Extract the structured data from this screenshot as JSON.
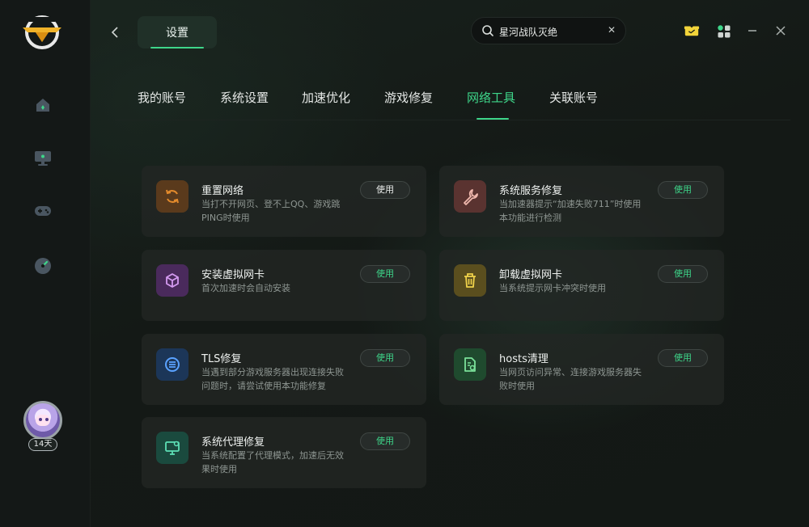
{
  "header": {
    "title": "设置",
    "search": {
      "value": "星河战队灭绝"
    }
  },
  "sidebar": {
    "days_badge": "14天",
    "items": [
      {
        "icon": "home-icon"
      },
      {
        "icon": "monitor-icon"
      },
      {
        "icon": "gamepad-icon"
      },
      {
        "icon": "speedometer-icon"
      }
    ]
  },
  "tabs": [
    "我的账号",
    "系统设置",
    "加速优化",
    "游戏修复",
    "网络工具",
    "关联账号"
  ],
  "active_tab": "网络工具",
  "tools": [
    {
      "title": "重置网络",
      "desc": "当打不开网页、登不上QQ、游戏跳PING时使用",
      "button": "使用",
      "icon": "refresh-icon",
      "color": "#c07a2c",
      "bg": "#5a3a1c"
    },
    {
      "title": "系统服务修复",
      "desc": "当加速器提示“加速失败711”时使用本功能进行检测",
      "button": "使用",
      "icon": "wrench-icon",
      "color": "#e7a59a",
      "bg": "#5a3330"
    },
    {
      "title": "安装虚拟网卡",
      "desc": "首次加速时会自动安装",
      "button": "使用",
      "icon": "cube-icon",
      "color": "#c68ae8",
      "bg": "#4a2a5c"
    },
    {
      "title": "卸载虚拟网卡",
      "desc": "当系统提示网卡冲突时使用",
      "button": "使用",
      "icon": "trash-icon",
      "color": "#e7c84a",
      "bg": "#5a4e1e"
    },
    {
      "title": "TLS修复",
      "desc": "当遇到部分游戏服务器出现连接失败问题时，请尝试使用本功能修复",
      "button": "使用",
      "icon": "tls-icon",
      "color": "#5aa2ff",
      "bg": "#1c3658"
    },
    {
      "title": "hosts清理",
      "desc": "当网页访问异常、连接游戏服务器失败时使用",
      "button": "使用",
      "icon": "file-clean-icon",
      "color": "#6fdc8c",
      "bg": "#1f4a2e"
    },
    {
      "title": "系统代理修复",
      "desc": "当系统配置了代理模式，加速后无效果时使用",
      "button": "使用",
      "icon": "monitor-settings-icon",
      "color": "#5de0b6",
      "bg": "#1a4a3e"
    }
  ],
  "colors": {
    "accent": "#3ed68a",
    "gift_icon": "#f2d43a"
  }
}
